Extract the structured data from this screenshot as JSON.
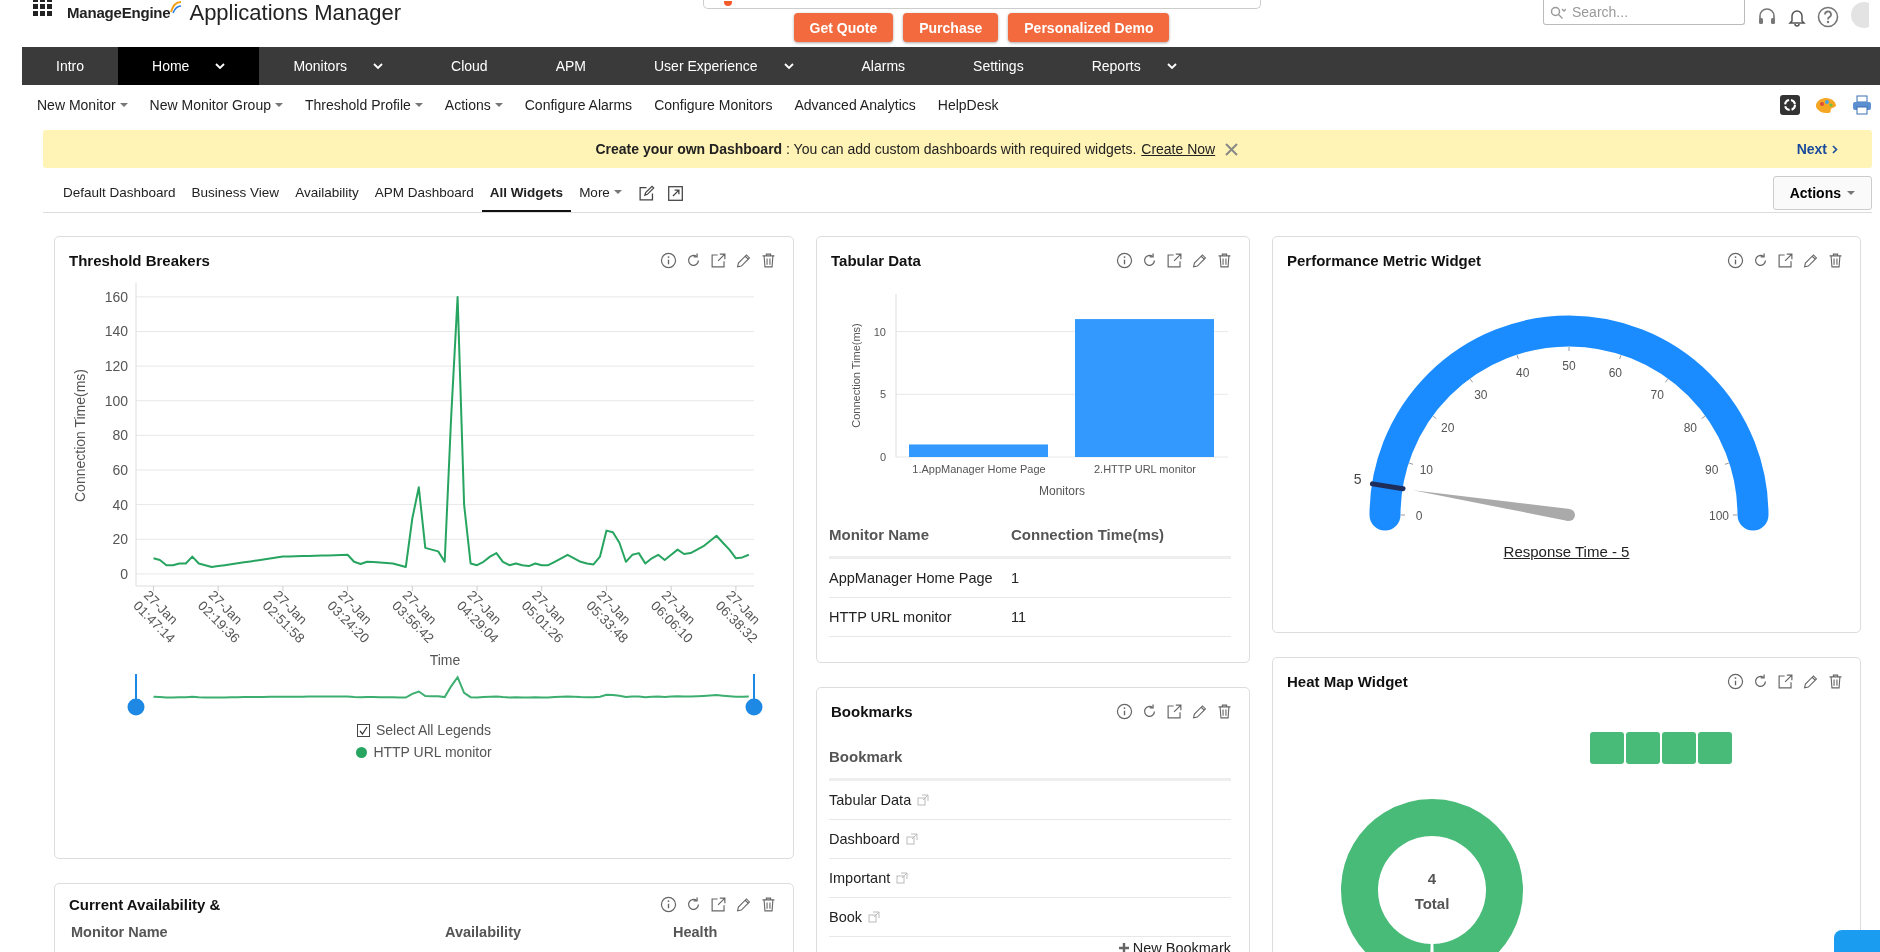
{
  "header": {
    "brand": "ManageEngine",
    "app_title": "Applications Manager",
    "buttons": [
      "Get Quote",
      "Purchase",
      "Personalized Demo"
    ],
    "search": {
      "placeholder": "Search..."
    }
  },
  "nav": [
    {
      "label": "Intro",
      "selected": false,
      "dropdown": false
    },
    {
      "label": "Home",
      "selected": true,
      "dropdown": true
    },
    {
      "label": "Monitors",
      "selected": false,
      "dropdown": true
    },
    {
      "label": "Cloud",
      "selected": false,
      "dropdown": false
    },
    {
      "label": "APM",
      "selected": false,
      "dropdown": false
    },
    {
      "label": "User Experience",
      "selected": false,
      "dropdown": true
    },
    {
      "label": "Alarms",
      "selected": false,
      "dropdown": false
    },
    {
      "label": "Settings",
      "selected": false,
      "dropdown": false
    },
    {
      "label": "Reports",
      "selected": false,
      "dropdown": true
    }
  ],
  "subnav": [
    {
      "label": "New Monitor",
      "dropdown": true
    },
    {
      "label": "New Monitor Group",
      "dropdown": true
    },
    {
      "label": "Threshold Profile",
      "dropdown": true
    },
    {
      "label": "Actions",
      "dropdown": true
    },
    {
      "label": "Configure Alarms",
      "dropdown": false
    },
    {
      "label": "Configure Monitors",
      "dropdown": false
    },
    {
      "label": "Advanced Analytics",
      "dropdown": false
    },
    {
      "label": "HelpDesk",
      "dropdown": false
    }
  ],
  "banner": {
    "text": "**Create your own Dashboard** : You can add custom dashboards with required widgets.",
    "link": "Create Now",
    "next": "Next"
  },
  "tabs": [
    {
      "label": "Default Dashboard",
      "selected": false,
      "dropdown": false
    },
    {
      "label": "Business View",
      "selected": false,
      "dropdown": false
    },
    {
      "label": "Availability",
      "selected": false,
      "dropdown": false
    },
    {
      "label": "APM Dashboard",
      "selected": false,
      "dropdown": false
    },
    {
      "label": "All Widgets",
      "selected": true,
      "dropdown": false
    },
    {
      "label": "More",
      "selected": false,
      "dropdown": true
    }
  ],
  "actions_button": "Actions",
  "widgets": {
    "threshold_breakers": {
      "title": "Threshold Breakers",
      "chart_data": {
        "type": "line",
        "grid": true,
        "ylim": [
          -7,
          168
        ],
        "xlabel": "Time",
        "ylabel": "Connection Time(ms)",
        "categories": [
          "27-Jan 01:47:14",
          null,
          null,
          null,
          null,
          null,
          null,
          null,
          null,
          null,
          "27-Jan 02:19:36",
          null,
          null,
          null,
          null,
          null,
          null,
          null,
          null,
          null,
          "27-Jan 02:51:58",
          null,
          null,
          null,
          null,
          null,
          null,
          null,
          null,
          null,
          "27-Jan 03:24:20",
          null,
          null,
          null,
          null,
          null,
          null,
          null,
          null,
          null,
          "27-Jan 03:56:42",
          null,
          null,
          null,
          null,
          null,
          null,
          null,
          null,
          null,
          "27-Jan 04:29:04",
          null,
          null,
          null,
          null,
          null,
          null,
          null,
          null,
          null,
          "27-Jan 05:01:26",
          null,
          null,
          null,
          null,
          null,
          null,
          null,
          null,
          null,
          "27-Jan 05:33:48",
          null,
          null,
          null,
          null,
          null,
          null,
          null,
          null,
          null,
          "27-Jan 06:06:10",
          null,
          null,
          null,
          null,
          null,
          null,
          null,
          null,
          null,
          "27-Jan 06:38:32",
          null,
          null
        ],
        "yticks": [
          0,
          20,
          40,
          60,
          80,
          100,
          120,
          140,
          160
        ],
        "series": [
          {
            "name": "HTTP URL monitor",
            "color": "#27a560",
            "values": [
              9,
              8,
              5,
              5,
              6,
              6,
              10,
              6,
              5,
              4,
              4.5,
              5,
              5.6,
              6.1,
              6.7,
              7.2,
              7.8,
              8.3,
              8.9,
              9.4,
              10,
              10.1,
              10.2,
              10.3,
              10.4,
              10.5,
              10.6,
              10.7,
              10.8,
              10.9,
              11,
              7,
              5.7,
              7,
              6.8,
              6.5,
              6.3,
              6,
              5,
              4,
              32,
              50,
              15,
              14,
              13,
              7,
              90,
              160,
              40,
              6,
              5,
              7,
              10,
              12,
              7,
              5,
              6,
              5,
              4.5,
              6,
              5,
              5,
              7,
              9,
              11,
              9,
              7,
              6,
              5.5,
              10,
              25,
              24,
              18,
              7,
              11,
              12,
              6,
              9,
              11,
              8,
              11,
              14,
              11.5,
              12,
              14,
              16,
              19,
              22,
              18,
              14,
              9,
              9.5,
              11
            ]
          }
        ]
      },
      "select_all": {
        "label": "Select All Legends",
        "checked": true
      }
    },
    "current_availability": {
      "title": "Current Availability &",
      "columns": [
        "Monitor Name",
        "Availability",
        "Health"
      ]
    },
    "tabular_data": {
      "title": "Tabular Data",
      "chart_data": {
        "type": "bar",
        "xlabel": "Monitors",
        "ylabel": "Connection Time(ms)",
        "categories": [
          "1.AppManager Home Page",
          "2.HTTP URL monitor"
        ],
        "values": [
          1,
          11
        ],
        "ylim": [
          0,
          13
        ],
        "yticks": [
          0,
          5,
          10
        ]
      },
      "table": {
        "columns": [
          "Monitor Name",
          "Connection Time(ms)"
        ],
        "rows": [
          [
            "AppManager Home Page",
            "1"
          ],
          [
            "HTTP URL monitor",
            "11"
          ]
        ]
      }
    },
    "bookmarks": {
      "title": "Bookmarks",
      "column": "Bookmark",
      "items": [
        "Tabular Data",
        "Dashboard",
        "Important",
        "Book"
      ],
      "add": "New Bookmark"
    },
    "performance_metric": {
      "title": "Performance Metric Widget",
      "gauge": {
        "ticks": [
          "0",
          "10",
          "20",
          "30",
          "40",
          "50",
          "60",
          "70",
          "80",
          "90",
          "100"
        ],
        "marker_label": "5"
      },
      "caption": "Response Time - 5"
    },
    "heat_map": {
      "title": "Heat Map Widget",
      "total": "4",
      "total_label": "Total",
      "cells": [
        {
          "color": "#48bb78"
        },
        {
          "color": "#48bb78"
        },
        {
          "color": "#48bb78"
        },
        {
          "color": "#48bb78"
        }
      ]
    }
  }
}
